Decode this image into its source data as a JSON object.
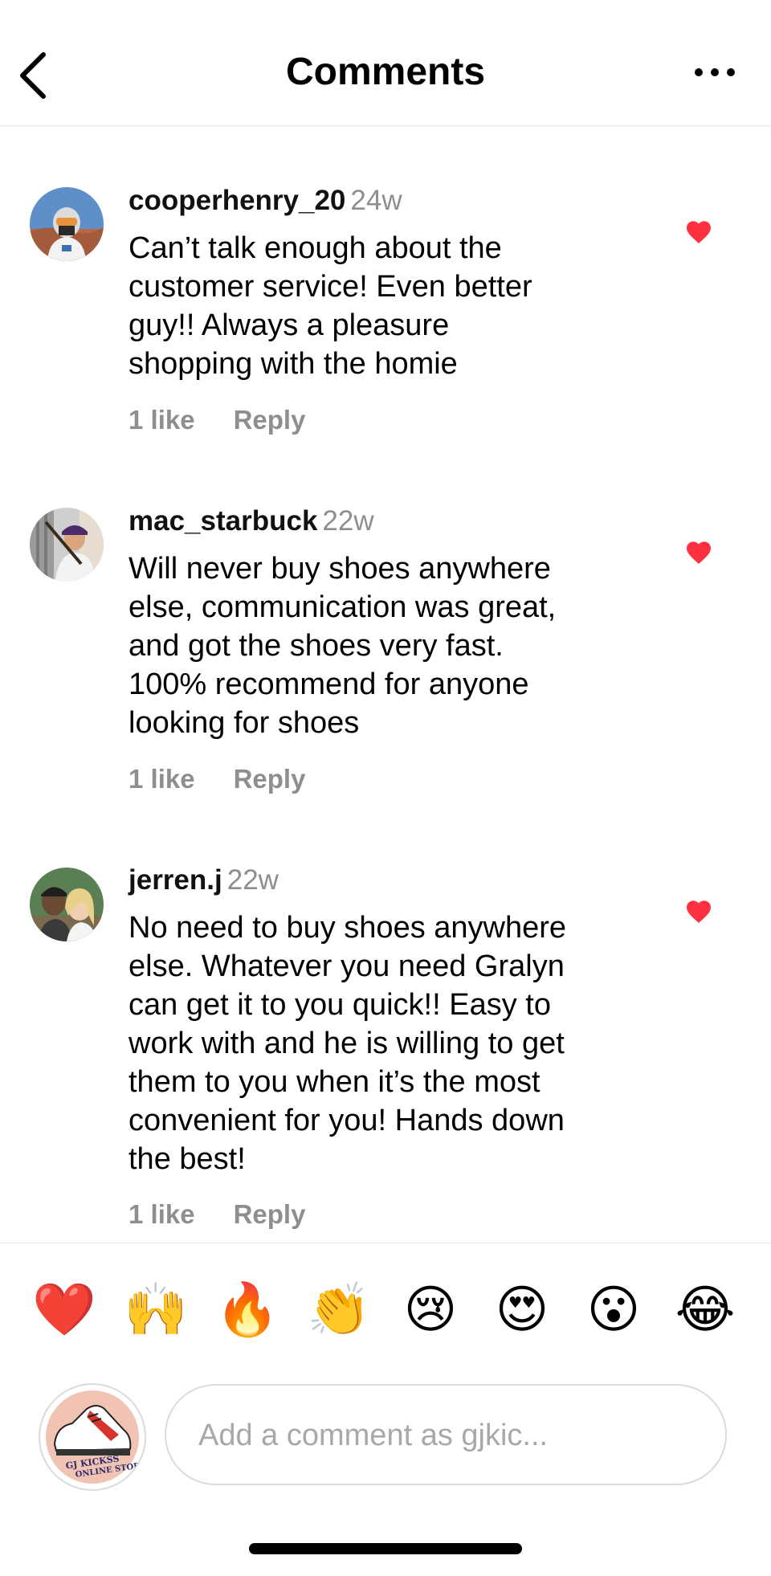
{
  "header": {
    "title": "Comments"
  },
  "comments": [
    {
      "username": "cooperhenry_20",
      "time": "24w",
      "lines": [
        "Can’t talk enough about the",
        "customer service! Even better",
        "guy!! Always a pleasure",
        "shopping with the homie"
      ],
      "likes": "1 like",
      "reply": "Reply",
      "liked": true
    },
    {
      "username": "mac_starbuck",
      "time": "22w",
      "lines": [
        "Will never buy shoes anywhere",
        "else, communication was great,",
        "and got the shoes very fast.",
        "100% recommend for anyone",
        "looking for shoes"
      ],
      "likes": "1 like",
      "reply": "Reply",
      "liked": true
    },
    {
      "username": "jerren.j",
      "time": "22w",
      "lines": [
        "No need to buy shoes anywhere",
        "else. Whatever you need Gralyn",
        "can get it to you quick!! Easy to",
        "work with and he is willing to get",
        "them to you when it’s the most",
        "convenient for you! Hands down",
        "the best!"
      ],
      "likes": "1 like",
      "reply": "Reply",
      "liked": true
    }
  ],
  "reactions": [
    {
      "name": "heart",
      "glyph": "❤️"
    },
    {
      "name": "raising-hands",
      "glyph": "🙌"
    },
    {
      "name": "fire",
      "glyph": "🔥"
    },
    {
      "name": "clapping-hands",
      "glyph": "👏"
    },
    {
      "name": "crying-face",
      "glyph": "😢"
    },
    {
      "name": "heart-eyes",
      "glyph": "😍"
    },
    {
      "name": "surprised-face",
      "glyph": "😮"
    },
    {
      "name": "tears-of-joy",
      "glyph": "😂"
    }
  ],
  "composer": {
    "placeholder": "Add a comment as gjkic...",
    "avatar_text_line1": "GJ KICKSS",
    "avatar_text_line2": "ONLINE STORE"
  },
  "colors": {
    "heart": "#ff3040",
    "muted": "#8e8e8e",
    "divider": "#e6e6e6"
  }
}
